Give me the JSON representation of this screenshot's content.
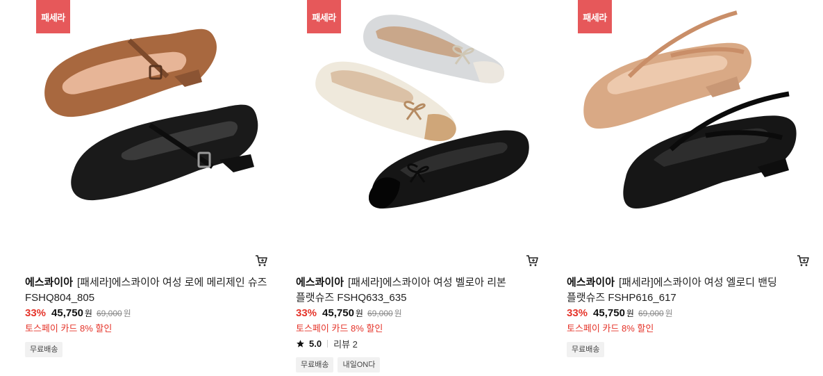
{
  "products": [
    {
      "badge": "패세라",
      "brand": "에스콰이아",
      "title": "[패세라]에스콰이아 여성 로에 메리제인 슈즈 FSHQ804_805",
      "discount": "33%",
      "price": "45,750",
      "price_unit": "원",
      "original_price": "69,000",
      "original_unit": "원",
      "promo": "토스페이 카드 8% 할인",
      "tags": [
        "무료배송"
      ],
      "image_colors": [
        "#a8683f",
        "#1a1a1a"
      ]
    },
    {
      "badge": "패세라",
      "brand": "에스콰이아",
      "title": "[패세라]에스콰이아 여성 벨로아 리본 플랫슈즈 FSHQ633_635",
      "discount": "33%",
      "price": "45,750",
      "price_unit": "원",
      "original_price": "69,000",
      "original_unit": "원",
      "promo": "토스페이 카드 8% 할인",
      "rating": "5.0",
      "review_label": "리뷰 2",
      "tags": [
        "무료배송",
        "내일ON다"
      ],
      "image_colors": [
        "#d8dadc",
        "#efe9dc",
        "#151515"
      ]
    },
    {
      "badge": "패세라",
      "brand": "에스콰이아",
      "title": "[패세라]에스콰이아 여성 엘로디 밴딩 플랫슈즈 FSHP616_617",
      "discount": "33%",
      "price": "45,750",
      "price_unit": "원",
      "original_price": "69,000",
      "original_unit": "원",
      "promo": "토스페이 카드 8% 할인",
      "tags": [
        "무료배송"
      ],
      "image_colors": [
        "#d9a985",
        "#161616"
      ]
    }
  ],
  "colors": {
    "badge_bg": "#e6585a",
    "accent_red": "#e5342a"
  },
  "icons": {
    "cart": "cart-icon",
    "star": "star-icon"
  }
}
